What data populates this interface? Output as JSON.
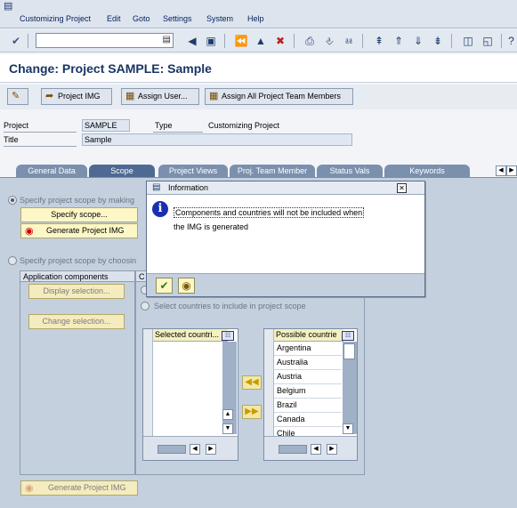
{
  "menu": {
    "items": [
      "Customizing Project",
      "Edit",
      "Goto",
      "Settings",
      "System",
      "Help"
    ]
  },
  "toolbar": {
    "command_value": "",
    "icons": [
      "enter-icon",
      "back-icon",
      "save-icon",
      "nav-back-icon",
      "exit-icon",
      "cancel-icon",
      "print-icon",
      "find-icon",
      "find-next-icon",
      "first-page-icon",
      "prev-page-icon",
      "next-page-icon",
      "last-page-icon",
      "new-session-icon",
      "shortcut-icon",
      "help-icon"
    ]
  },
  "title": "Change: Project SAMPLE: Sample",
  "app_toolbar": {
    "project_img": "Project IMG",
    "assign_user": "Assign User...",
    "assign_all": "Assign All Project Team Members"
  },
  "header": {
    "project_label": "Project",
    "project_value": "SAMPLE",
    "type_label": "Type",
    "type_value": "Customizing Project",
    "title_label": "Title",
    "title_value": "Sample"
  },
  "tabs": [
    "General Data",
    "Scope",
    "Project Views",
    "Proj. Team Member",
    "Status Vals",
    "Keywords"
  ],
  "scope": {
    "radio1_label": "Specify project scope by making",
    "specify_scope_btn": "Specify scope...",
    "generate_img_btn": "Generate Project IMG",
    "radio2_label": "Specify project scope by choosin",
    "app_components_header": "Application components",
    "display_selection_btn": "Display selection...",
    "change_selection_btn": "Change selection...",
    "countries_header": "C",
    "countries_radio_label": "Select countries to include in project scope",
    "selected_header": "Selected countri...",
    "possible_header": "Possible countrie",
    "possible_countries": [
      "Argentina",
      "Australia",
      "Austria",
      "Belgium",
      "Brazil",
      "Canada",
      "Chile"
    ],
    "bottom_generate_btn": "Generate Project IMG"
  },
  "dialog": {
    "title": "Information",
    "line1": "Components and countries will not be included when",
    "line2": "the IMG is generated"
  },
  "colors": {
    "accent": "#1a3564",
    "tab": "#7b90ad",
    "panel": "#c5d0de"
  }
}
